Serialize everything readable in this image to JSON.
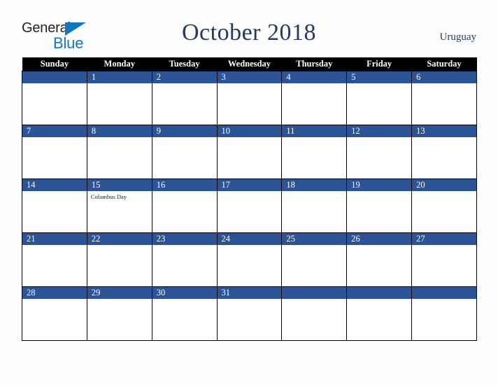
{
  "brand": {
    "name_part1": "General",
    "name_part2": "Blue",
    "triangle_icon": "blue-triangle-icon",
    "color_dark": "#231f20",
    "color_blue": "#1277bf"
  },
  "header": {
    "title": "October 2018",
    "region": "Uruguay",
    "title_color": "#27395e"
  },
  "calendar": {
    "weekday_headers": [
      "Sunday",
      "Monday",
      "Tuesday",
      "Wednesday",
      "Thursday",
      "Friday",
      "Saturday"
    ],
    "header_bg": "#000000",
    "datebar_bg": "#2c5396",
    "cell_bg": "#ffffff",
    "grid_line": "#000000",
    "weeks": [
      [
        {
          "date": "",
          "events": []
        },
        {
          "date": "1",
          "events": []
        },
        {
          "date": "2",
          "events": []
        },
        {
          "date": "3",
          "events": []
        },
        {
          "date": "4",
          "events": []
        },
        {
          "date": "5",
          "events": []
        },
        {
          "date": "6",
          "events": []
        }
      ],
      [
        {
          "date": "7",
          "events": []
        },
        {
          "date": "8",
          "events": []
        },
        {
          "date": "9",
          "events": []
        },
        {
          "date": "10",
          "events": []
        },
        {
          "date": "11",
          "events": []
        },
        {
          "date": "12",
          "events": []
        },
        {
          "date": "13",
          "events": []
        }
      ],
      [
        {
          "date": "14",
          "events": []
        },
        {
          "date": "15",
          "events": [
            "Columbus Day"
          ]
        },
        {
          "date": "16",
          "events": []
        },
        {
          "date": "17",
          "events": []
        },
        {
          "date": "18",
          "events": []
        },
        {
          "date": "19",
          "events": []
        },
        {
          "date": "20",
          "events": []
        }
      ],
      [
        {
          "date": "21",
          "events": []
        },
        {
          "date": "22",
          "events": []
        },
        {
          "date": "23",
          "events": []
        },
        {
          "date": "24",
          "events": []
        },
        {
          "date": "25",
          "events": []
        },
        {
          "date": "26",
          "events": []
        },
        {
          "date": "27",
          "events": []
        }
      ],
      [
        {
          "date": "28",
          "events": []
        },
        {
          "date": "29",
          "events": []
        },
        {
          "date": "30",
          "events": []
        },
        {
          "date": "31",
          "events": []
        },
        {
          "date": "",
          "events": []
        },
        {
          "date": "",
          "events": []
        },
        {
          "date": "",
          "events": []
        }
      ]
    ]
  }
}
